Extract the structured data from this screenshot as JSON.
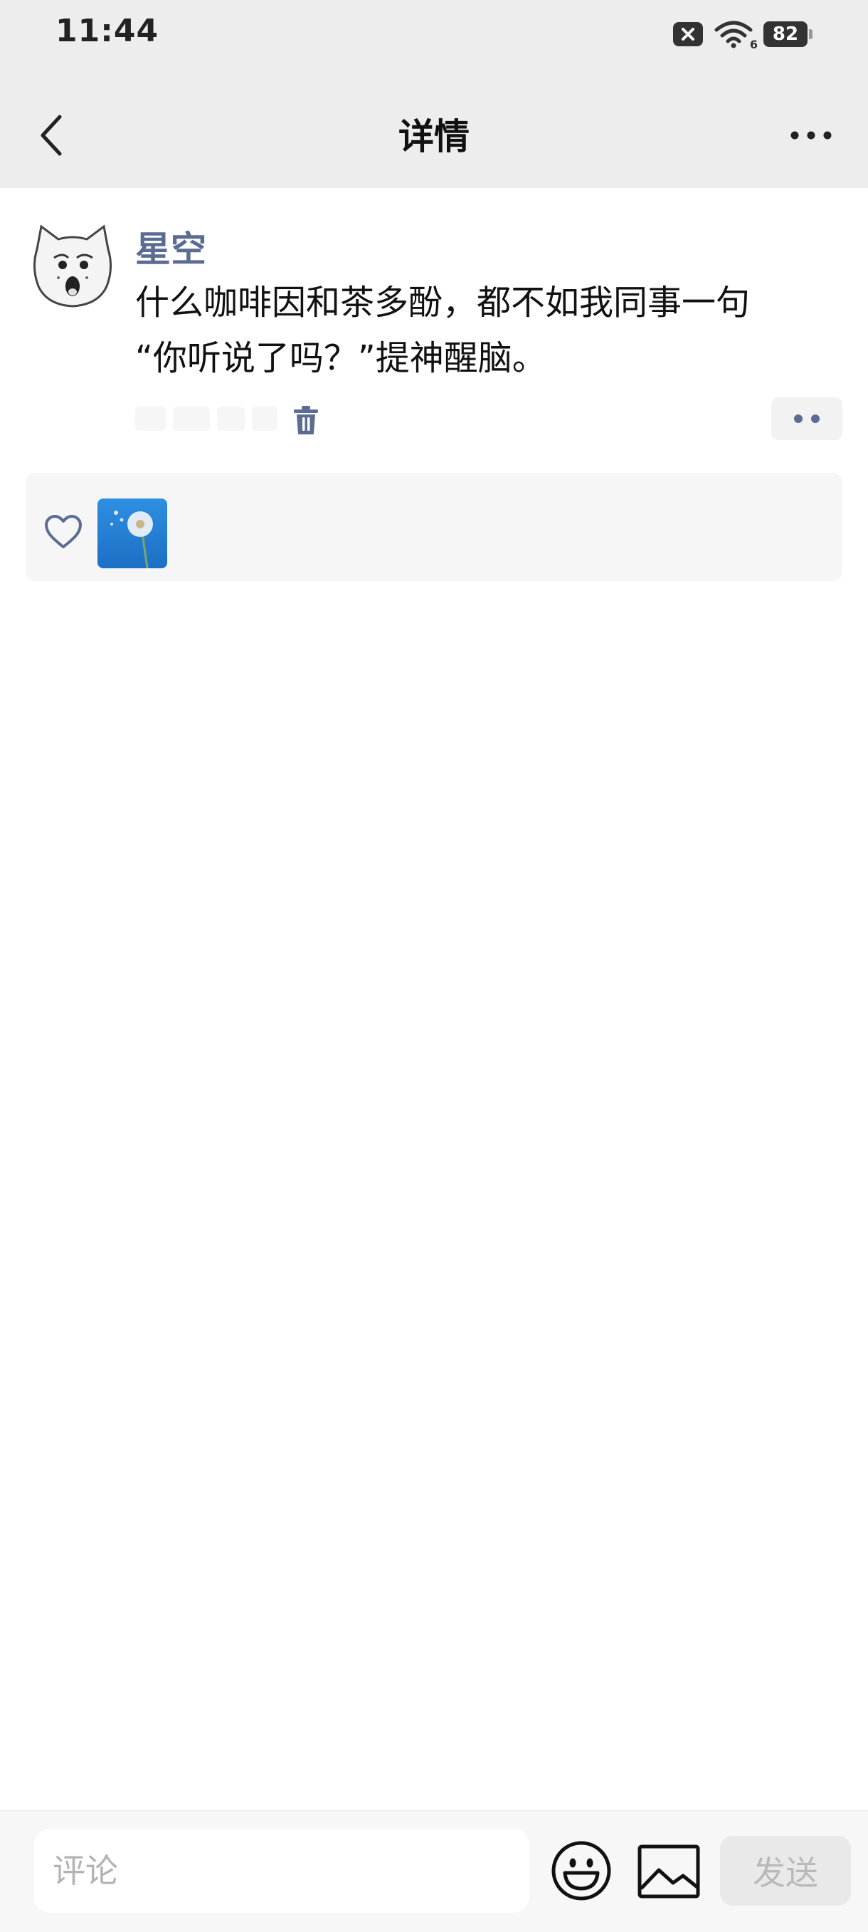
{
  "status_bar": {
    "time": "11:44",
    "battery": "82",
    "wifi_badge": "6"
  },
  "nav": {
    "title": "详情"
  },
  "post": {
    "username": "星空",
    "text": "什么咖啡因和茶多酚，都不如我同事一句\n“你听说了吗？”提神醒脑。"
  },
  "likes": {
    "icon": "heart-outline-icon"
  },
  "composer": {
    "placeholder": "评论",
    "send_label": "发送"
  },
  "colors": {
    "accent": "#5b6b92",
    "nav_bg": "#ededed",
    "likes_bg": "#f6f6f6"
  }
}
